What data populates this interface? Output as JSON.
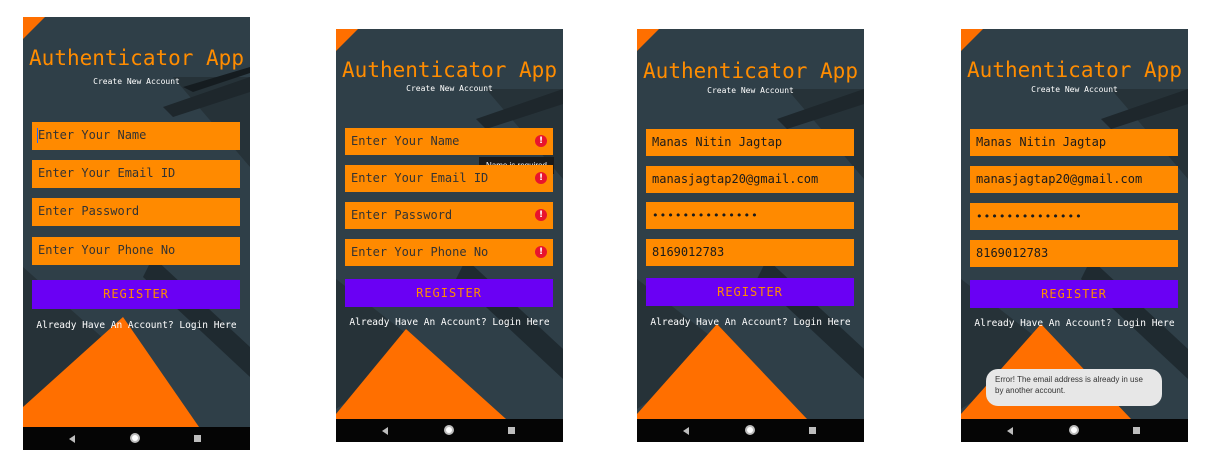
{
  "app_title": "Authenticator App",
  "subtitle": "Create New Account",
  "register_label": "REGISTER",
  "login_link": "Already Have An Account? Login Here",
  "placeholders": {
    "name": "Enter Your Name",
    "email": "Enter Your Email ID",
    "password": "Enter Password",
    "phone": "Enter Your Phone No"
  },
  "values": {
    "name": "Manas Nitin Jagtap",
    "email": "manasjagtap20@gmail.com",
    "password_mask": "••••••••••••••",
    "phone": "8169012783"
  },
  "errors": {
    "name_tooltip": "Name is required",
    "toast": "Error! The email address is already in use by another account."
  },
  "colors": {
    "background": "#2f3f48",
    "field": "#ff8a00",
    "title": "#ff8c00",
    "button": "#6a00f4",
    "accent_shape": "#ff6f00",
    "error_icon": "#e8142d"
  },
  "screens": [
    {
      "state": "empty-form-focused-name"
    },
    {
      "state": "validation-errors"
    },
    {
      "state": "filled-form"
    },
    {
      "state": "email-already-in-use-error"
    }
  ]
}
